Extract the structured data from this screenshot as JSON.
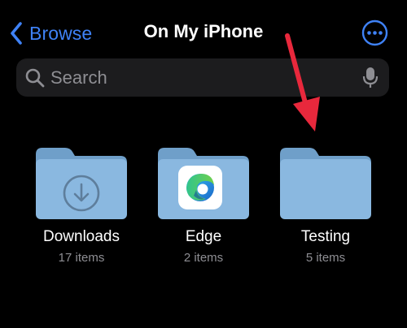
{
  "nav": {
    "back_label": "Browse",
    "title": "On My iPhone",
    "back_icon": "chevron-left-icon",
    "more_icon": "ellipsis-circle-icon"
  },
  "search": {
    "placeholder": "Search",
    "value": "",
    "leading_icon": "magnifying-glass-icon",
    "trailing_icon": "microphone-icon"
  },
  "folders": [
    {
      "name": "Downloads",
      "count": "17 items",
      "badge_icon": "download-arrow-icon"
    },
    {
      "name": "Edge",
      "count": "2 items",
      "badge_icon": "edge-app-icon"
    },
    {
      "name": "Testing",
      "count": "5 items",
      "badge_icon": ""
    }
  ],
  "colors": {
    "background": "#000000",
    "accent": "#3f82f6",
    "folder_body": "#8ab8e0",
    "folder_tab": "#6f9fc9",
    "secondary_text": "#8e8e93",
    "annotation_arrow": "#e8283c"
  }
}
